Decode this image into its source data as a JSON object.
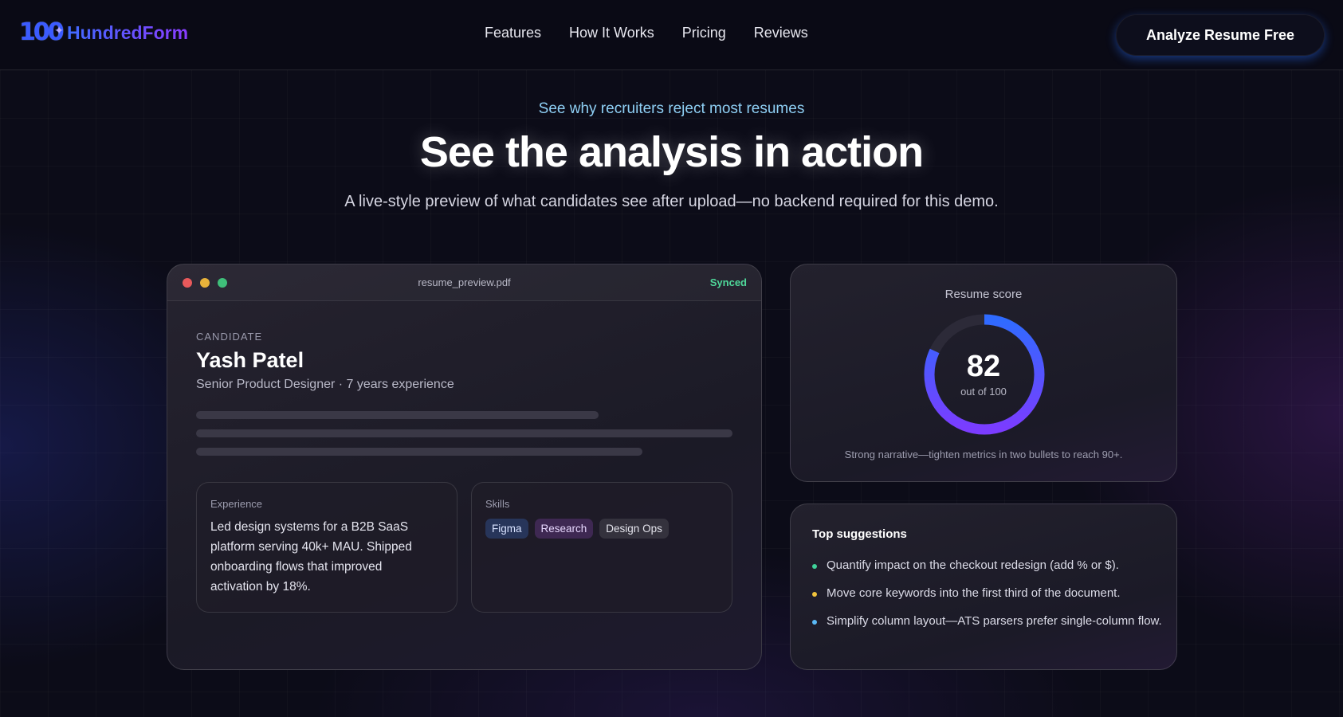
{
  "nav": {
    "brand": "HundredForm",
    "logo_mark": "100",
    "links": [
      "Features",
      "How It Works",
      "Pricing",
      "Reviews"
    ],
    "cta_label": "Analyze Resume Free"
  },
  "hero": {
    "eyebrow": "See why recruiters reject most resumes",
    "title": "See the analysis in action",
    "subtitle": "A live-style preview of what candidates see after upload—no backend required for this demo."
  },
  "preview": {
    "file_name": "resume_preview.pdf",
    "status": "Synced",
    "candidate_label": "CANDIDATE",
    "candidate_name": "Yash Patel",
    "candidate_role": "Senior Product Designer · 7 years experience",
    "experience_title": "Experience",
    "experience_text": "Led design systems for a B2B SaaS platform serving 40k+ MAU. Shipped onboarding flows that improved activation by 18%.",
    "skills_title": "Skills",
    "skills": [
      "Figma",
      "Research",
      "Design Ops"
    ]
  },
  "score": {
    "title": "Resume score",
    "value": "82",
    "out_of": "out of 100",
    "fraction": 0.82,
    "note": "Strong narrative—tighten metrics in two bullets to reach 90+.",
    "colors": {
      "start": "#7b3cff",
      "end": "#2f6bff",
      "track": "#2c2a38"
    }
  },
  "suggestions": {
    "title": "Top suggestions",
    "items": [
      {
        "text": "Quantify impact on the checkout redesign (add % or $).",
        "color": "#3fd29a"
      },
      {
        "text": "Move core keywords into the first third of the document.",
        "color": "#f0c33c"
      },
      {
        "text": "Simplify column layout—ATS parsers prefer single-column flow.",
        "color": "#5ab8f5"
      }
    ]
  }
}
